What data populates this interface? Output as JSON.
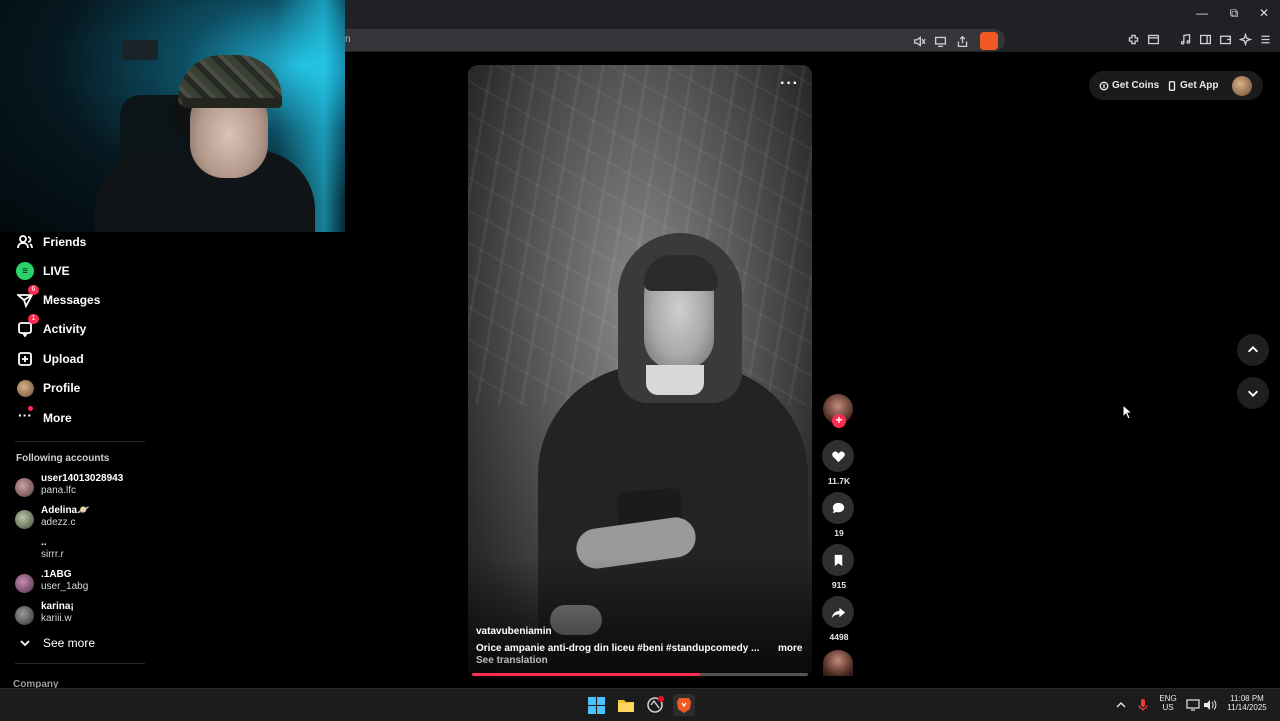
{
  "browser": {
    "url_fragment": "n",
    "window_controls": [
      "minimize",
      "restore",
      "close"
    ],
    "accent": "#f15a24"
  },
  "sidebar": {
    "nav": [
      {
        "label": "Friends",
        "icon": "friends-icon"
      },
      {
        "label": "LIVE",
        "icon": "live-icon"
      },
      {
        "label": "Messages",
        "icon": "messages-icon",
        "badge": "6"
      },
      {
        "label": "Activity",
        "icon": "activity-icon",
        "badge": "1"
      },
      {
        "label": "Upload",
        "icon": "upload-icon"
      },
      {
        "label": "Profile",
        "icon": "profile-icon"
      },
      {
        "label": "More",
        "icon": "more-icon"
      }
    ],
    "following_title": "Following accounts",
    "accounts": [
      {
        "name": "user14013028943",
        "handle": "pana.lfc"
      },
      {
        "name": "Adelina🪐",
        "handle": "adezz.c"
      },
      {
        "name": "..",
        "handle": "sirrr.r"
      },
      {
        "name": ".1ABG",
        "handle": "user_1abg"
      },
      {
        "name": "karina¡",
        "handle": "kariii.w"
      }
    ],
    "see_more": "See more",
    "company": "Company"
  },
  "video": {
    "menu": "···",
    "author": "vatavubeniamin",
    "caption": "Orice ampanie anti-drog din liceu #beni  #standupcomedy  ...",
    "more": "more",
    "see_translation": "See translation",
    "progress": 0.68,
    "accent": "#fe2c55"
  },
  "actions": {
    "likes": "11.7K",
    "comments": "19",
    "saves": "915",
    "shares": "4498"
  },
  "top": {
    "get_coins": "Get Coins",
    "get_app": "Get App"
  },
  "taskbar": {
    "lang": "ENG",
    "region": "US",
    "time": "11:08 PM",
    "date": "11/14/2025"
  }
}
